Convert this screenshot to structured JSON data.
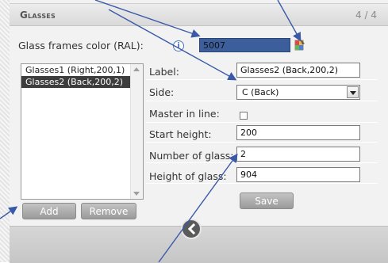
{
  "panel": {
    "title": "Glasses",
    "counter": "4 / 4"
  },
  "frames_color": {
    "label": "Glass frames color (RAL):",
    "info_glyph": "i",
    "value": "5007",
    "color": "#3c5f9c"
  },
  "glasses_list": {
    "items": [
      {
        "label": "Glasses1 (Right,200,1)",
        "selected": false
      },
      {
        "label": "Glasses2 (Back,200,2)",
        "selected": true
      }
    ]
  },
  "list_actions": {
    "add_label": "Add",
    "remove_label": "Remove"
  },
  "form": {
    "label_label": "Label:",
    "label_value": "Glasses2 (Back,200,2)",
    "side_label": "Side:",
    "side_value": "C (Back)",
    "master_label": "Master in line:",
    "master_checked": false,
    "start_height_label": "Start height:",
    "start_height_value": "200",
    "number_label": "Number of glass:",
    "number_value": "2",
    "height_label": "Height of glass:",
    "height_value": "904",
    "save_label": "Save"
  },
  "annotation_color": "#3a59a8"
}
